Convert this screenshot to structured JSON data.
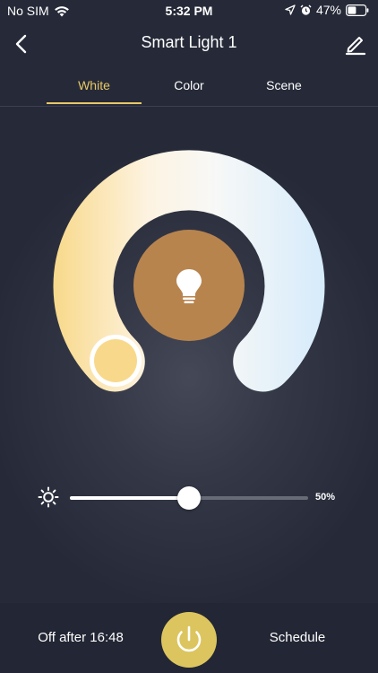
{
  "status_bar": {
    "carrier": "No SIM",
    "time": "5:32 PM",
    "battery": "47%",
    "icons": [
      "wifi-icon",
      "location-arrow-icon",
      "alarm-icon",
      "battery-icon"
    ]
  },
  "header": {
    "title": "Smart Light 1",
    "back_icon": "chevron-left-icon",
    "edit_icon": "pencil-icon"
  },
  "tabs": [
    {
      "label": "White",
      "active": true
    },
    {
      "label": "Color",
      "active": false
    },
    {
      "label": "Scene",
      "active": false
    }
  ],
  "dial": {
    "warm_color": "#f8d98b",
    "cool_color": "#d6ebfb",
    "bulb_color": "#b8844e",
    "selected_temperature": 0,
    "center_icon": "lightbulb-icon"
  },
  "brightness": {
    "icon": "sun-icon",
    "value": 50,
    "label": "50%"
  },
  "bottom_bar": {
    "timer_label": "Off after 16:48",
    "schedule_label": "Schedule",
    "power_icon": "power-icon",
    "power_color": "#dcc55e"
  },
  "colors": {
    "accent": "#e7c866",
    "background": "#262a38"
  }
}
